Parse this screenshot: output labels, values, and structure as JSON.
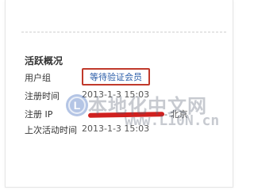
{
  "activity": {
    "section_title": "活跃概况",
    "user_group": {
      "label": "用户组",
      "value": "等待验证会员"
    },
    "register_time": {
      "label": "注册时间",
      "value": "2013-1-3 15:03"
    },
    "register_ip": {
      "label": "注册 IP",
      "value": "- 北京"
    },
    "last_active": {
      "label": "上次活动时间",
      "value": "2013-1-3 15:03"
    }
  },
  "watermark": {
    "text": "本地化中文网",
    "url": "www.L10N.cn"
  },
  "colors": {
    "highlight_border": "#c0392b",
    "redaction": "#d0201f",
    "link": "#2a5ca8"
  }
}
